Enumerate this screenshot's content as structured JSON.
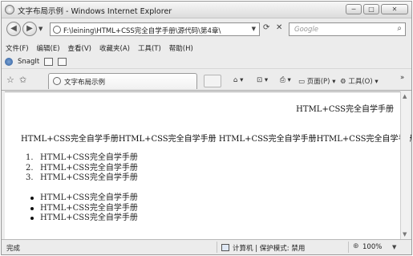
{
  "window": {
    "title": "文字布局示例 - Windows Internet Explorer"
  },
  "window_controls": {
    "minimize": "─",
    "maximize": "□",
    "close": "✕"
  },
  "address": {
    "url": "F:\\leining\\HTML+CSS完全自学手册\\源代码\\第4章\\",
    "search_placeholder": "Google"
  },
  "menu": [
    "文件(F)",
    "编辑(E)",
    "查看(V)",
    "收藏夹(A)",
    "工具(T)",
    "帮助(H)"
  ],
  "snagit": {
    "label": "SnagIt"
  },
  "tab": {
    "label": "文字布局示例"
  },
  "commands": {
    "page": "页面(P)",
    "tools": "工具(O)"
  },
  "content": {
    "right_aligned": "HTML+CSS完全自学手册",
    "inline_row": "HTML+CSS完全自学手册HTML+CSS完全自学手册 HTML+CSS完全自学手册HTML+CSS完全自学手册",
    "ordered_list": [
      {
        "num": "1.",
        "text": "HTML+CSS完全自学手册"
      },
      {
        "num": "2.",
        "text": "HTML+CSS完全自学手册"
      },
      {
        "num": "3.",
        "text": "HTML+CSS完全自学手册"
      }
    ],
    "unordered_list": [
      "HTML+CSS完全自学手册",
      "HTML+CSS完全自学手册",
      "HTML+CSS完全自学手册"
    ]
  },
  "status": {
    "text": "完成",
    "zone": "计算机 | 保护模式: 禁用",
    "zoom": "100%"
  },
  "icons": {
    "back": "back-arrow-icon",
    "forward": "forward-arrow-icon",
    "refresh": "refresh-icon",
    "stop": "stop-icon",
    "search": "search-icon",
    "favorites": "favorites-star-icon",
    "add_favorite": "add-favorite-icon",
    "home": "home-icon",
    "feeds": "feeds-icon",
    "print": "print-icon",
    "zoom": "zoom-icon"
  }
}
